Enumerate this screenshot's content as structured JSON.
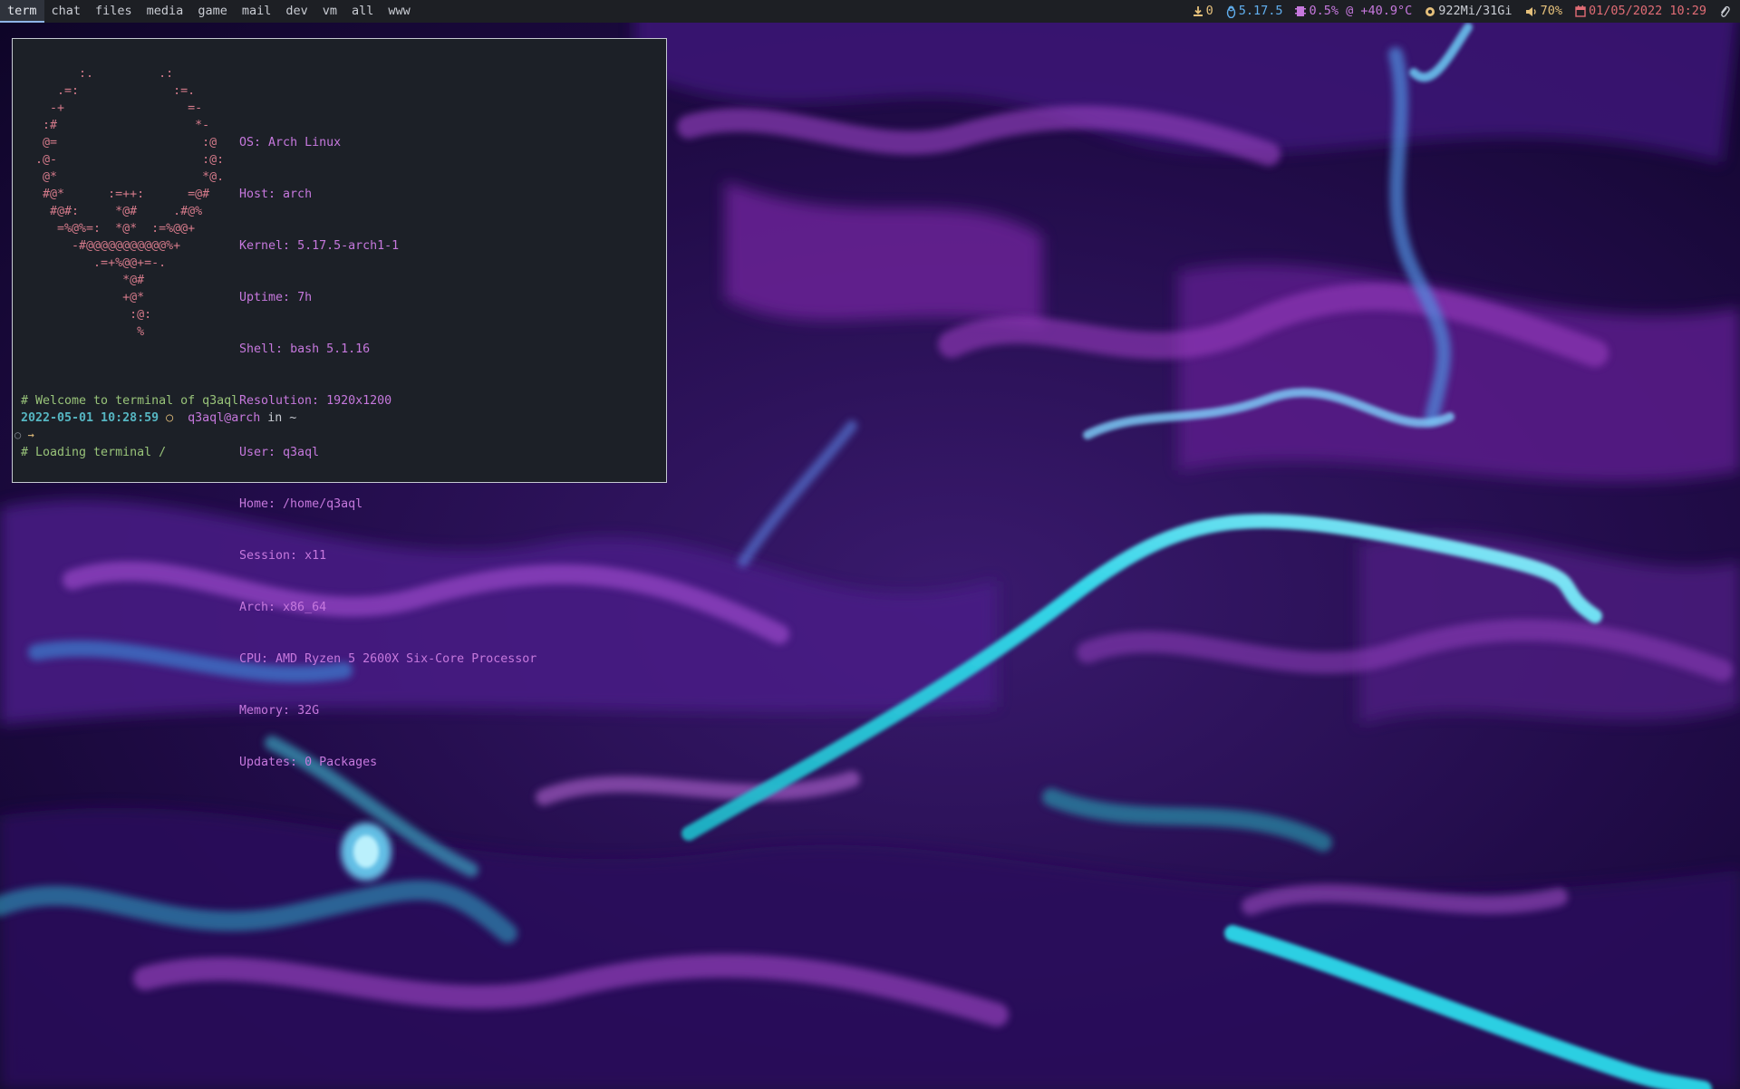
{
  "workspaces": [
    {
      "label": "term",
      "active": true
    },
    {
      "label": "chat",
      "active": false
    },
    {
      "label": "files",
      "active": false
    },
    {
      "label": "media",
      "active": false
    },
    {
      "label": "game",
      "active": false
    },
    {
      "label": "mail",
      "active": false
    },
    {
      "label": "dev",
      "active": false
    },
    {
      "label": "vm",
      "active": false
    },
    {
      "label": "all",
      "active": false
    },
    {
      "label": "www",
      "active": false
    }
  ],
  "status": {
    "updates": {
      "icon": "download-icon",
      "value": "0",
      "color": "#e5c07b"
    },
    "kernel": {
      "icon": "linux-tux-icon",
      "value": "5.17.5",
      "color": "#61afef"
    },
    "cpu": {
      "icon": "cpu-chip-icon",
      "value": "0.5% @ +40.9°C",
      "color": "#c678dd"
    },
    "memory": {
      "icon": "memory-icon",
      "value": "922Mi/31Gi",
      "color": "#c9ccd3"
    },
    "volume": {
      "icon": "speaker-icon",
      "value": "70%",
      "color": "#e5c07b"
    },
    "clock": {
      "icon": "calendar-icon",
      "value": "01/05/2022 10:29",
      "color": "#e06c75"
    },
    "tray": {
      "icon": "paperclip-icon"
    }
  },
  "terminal": {
    "art": [
      "        :.         .:",
      "     .=:             :=.",
      "    -+                 =-",
      "   :#                   *-",
      "   @=                    :@",
      "  .@-                    :@:",
      "   @*                    *@.",
      "   #@*      :=++:      =@#",
      "    #@#:     *@#     .#@%",
      "     =%@%=:  *@*  :=%@@+",
      "       -#@@@@@@@@@@@%+",
      "          .=+%@@+=-.",
      "              *@#",
      "              +@*",
      "               :@:",
      "                %"
    ],
    "info": [
      {
        "key": "OS:",
        "value": "Arch Linux"
      },
      {
        "key": "Host:",
        "value": "arch"
      },
      {
        "key": "Kernel:",
        "value": "5.17.5-arch1-1"
      },
      {
        "key": "Uptime:",
        "value": "7h"
      },
      {
        "key": "Shell:",
        "value": "bash 5.1.16"
      },
      {
        "key": "Resolution:",
        "value": "1920x1200"
      },
      {
        "key": "User:",
        "value": "q3aql"
      },
      {
        "key": "Home:",
        "value": "/home/q3aql"
      },
      {
        "key": "Session:",
        "value": "x11"
      },
      {
        "key": "Arch:",
        "value": "x86_64"
      },
      {
        "key": "CPU:",
        "value": "AMD Ryzen 5 2600X Six-Core Processor"
      },
      {
        "key": "Memory:",
        "value": "32G"
      },
      {
        "key": "Updates:",
        "value": "0 Packages"
      }
    ],
    "welcome": [
      "# Welcome to terminal of q3aql",
      "# Loading terminal /"
    ],
    "prompt": {
      "timestamp": "2022-05-01 10:28:59",
      "dot": "○",
      "user_host": "q3aql@arch",
      "in_word": "in",
      "path": "~"
    },
    "cmdline": {
      "marker": "○",
      "arrow": "→"
    }
  }
}
